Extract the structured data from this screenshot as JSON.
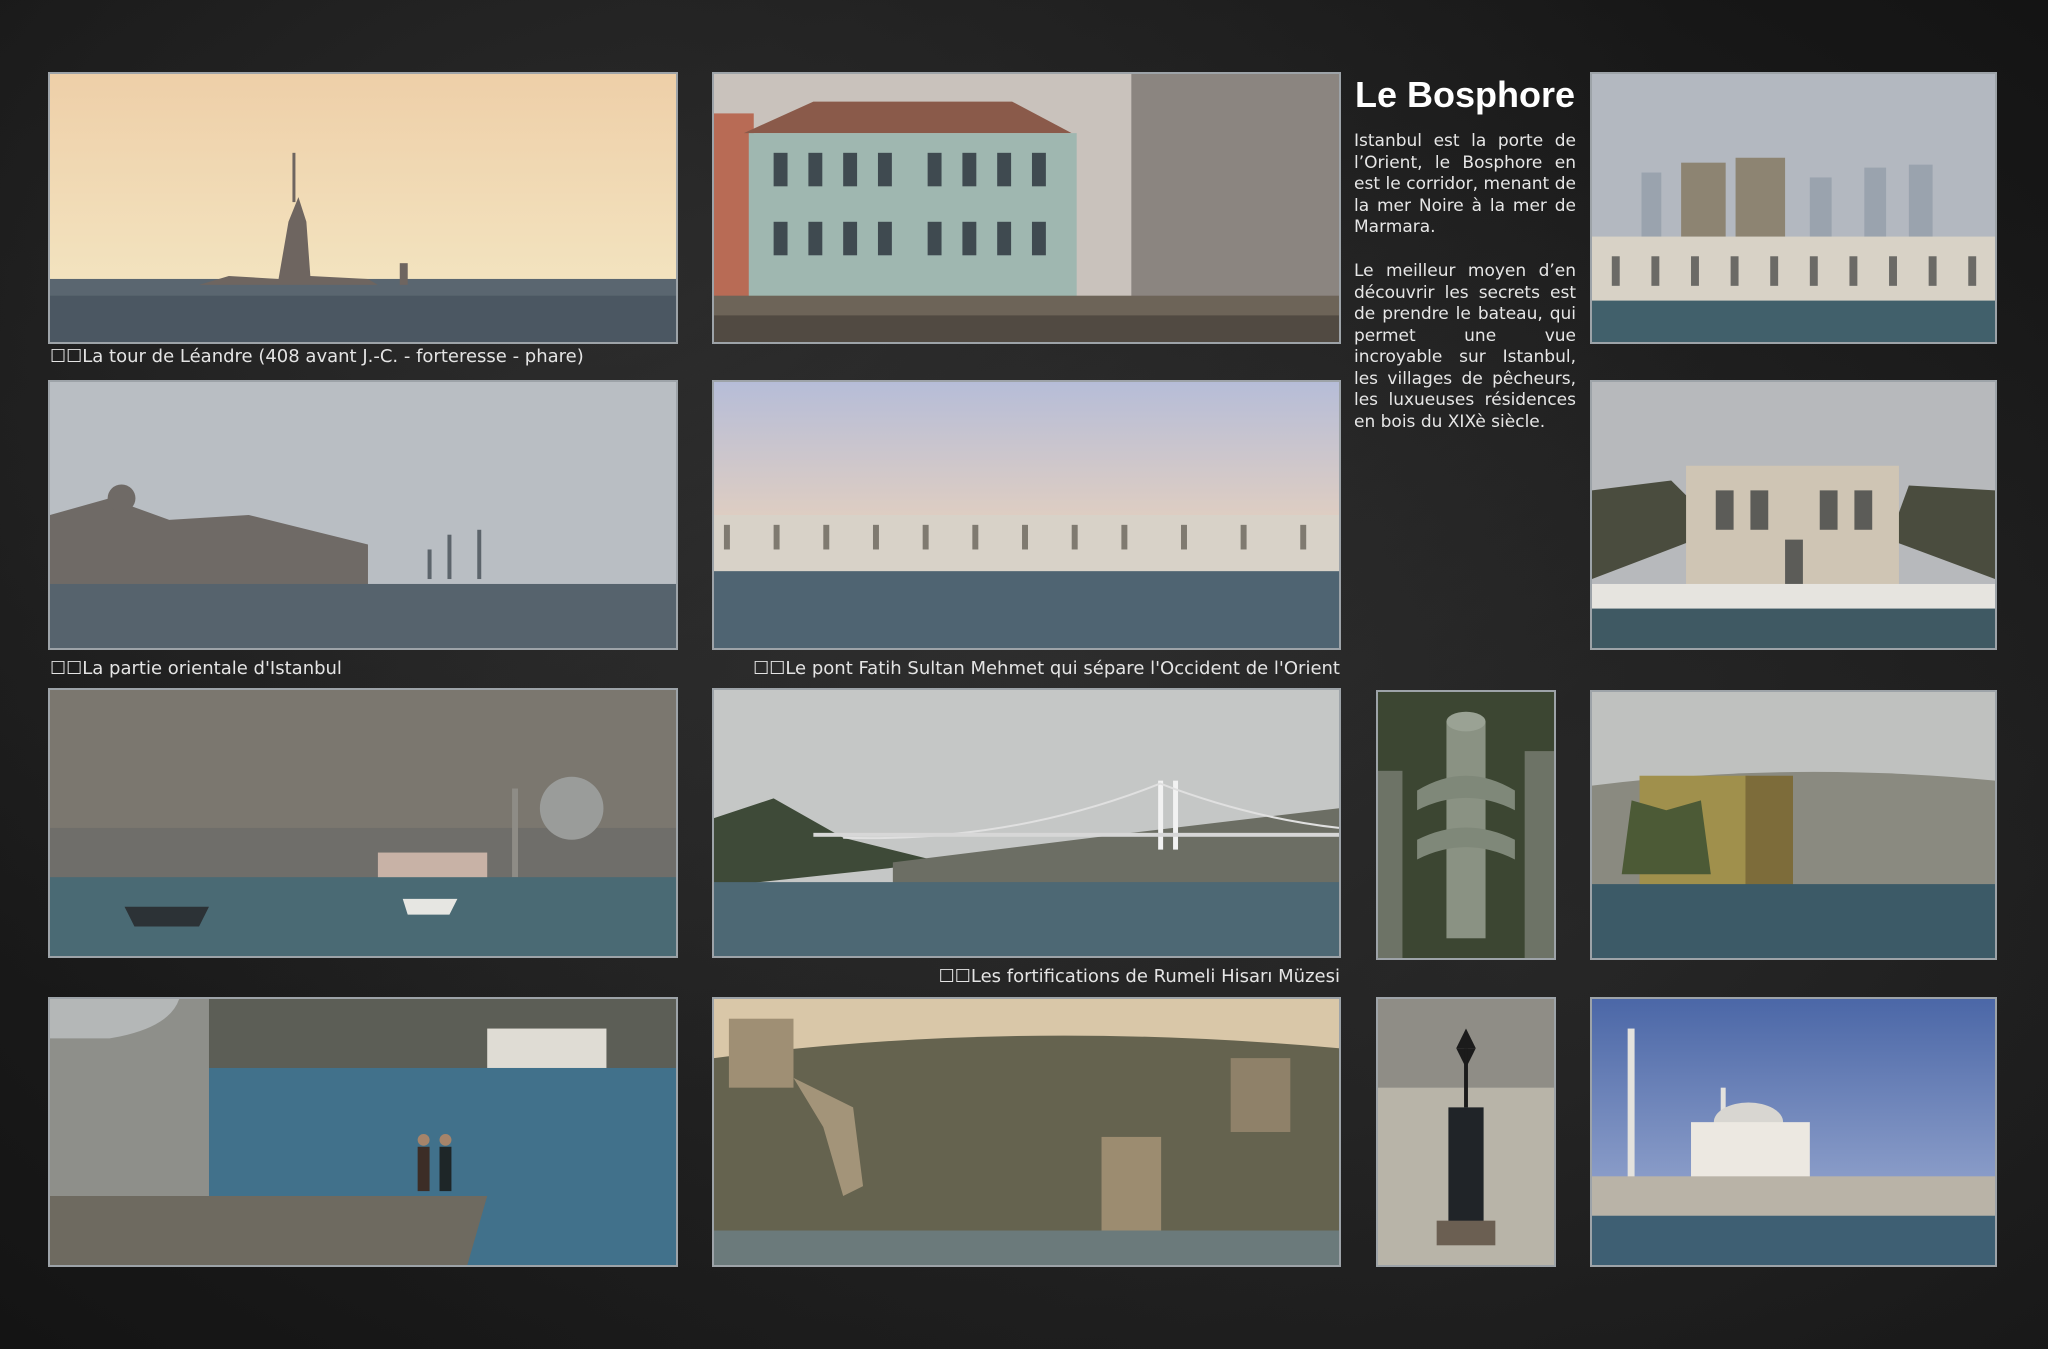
{
  "title": "Le Bosphore",
  "paragraphs": [
    "Istanbul est la porte de l’Orient, le Bosphore en est le corridor, menant de la mer Noire à la mer de Marmara.",
    "Le meilleur moyen d’en découvrir les secrets est de prendre le bateau, qui permet une vue incroyable sur Istanbul, les villages de pêcheurs, les luxueuses résidences en bois du XIXè siècle."
  ],
  "captions": {
    "leander": "☐☐La tour de Léandre (408 avant J.-C. - forteresse - phare)",
    "oriental": "☐☐La partie orientale d'Istanbul",
    "bridge": "☐☐Le pont Fatih Sultan Mehmet qui sépare l'Occident de l'Orient",
    "rumeli": "☐☐Les fortifications de Rumeli Hisarı Müzesi"
  }
}
